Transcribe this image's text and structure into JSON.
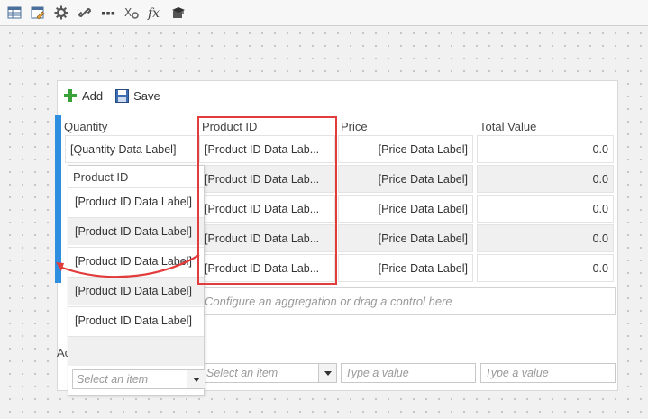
{
  "toolbar": {
    "icons": [
      "table-icon",
      "edit-form-icon",
      "gear-icon",
      "link-icon",
      "ellipsis-icon",
      "settings-code-icon",
      "function-icon",
      "graduation-cap-icon"
    ]
  },
  "commands": {
    "add_label": "Add",
    "save_label": "Save"
  },
  "columns": {
    "quantity": "Quantity",
    "product_id": "Product ID",
    "price": "Price",
    "total_value": "Total Value"
  },
  "rows": [
    {
      "quantity": "[Quantity Data Label]",
      "product_id": "[Product ID Data Lab...",
      "price": "[Price Data Label]",
      "total": "0.0"
    },
    {
      "quantity": "",
      "product_id": "[Product ID Data Lab...",
      "price": "[Price Data Label]",
      "total": "0.0"
    },
    {
      "quantity": "",
      "product_id": "[Product ID Data Lab...",
      "price": "[Price Data Label]",
      "total": "0.0"
    },
    {
      "quantity": "",
      "product_id": "[Product ID Data Lab...",
      "price": "[Price Data Label]",
      "total": "0.0"
    },
    {
      "quantity": "",
      "product_id": "[Product ID Data Lab...",
      "price": "[Price Data Label]",
      "total": "0.0"
    }
  ],
  "aggregation_placeholder": "Configure an aggregation or drag a control here",
  "aggregation_row": {
    "select_placeholder": "Select an item",
    "value_placeholder_1": "Type a value",
    "value_placeholder_2": "Type a value"
  },
  "drag_ghost": {
    "header": "Product ID",
    "cells": [
      "[Product ID Data Label]",
      "[Product ID Data Label]",
      "[Product ID Data Label]",
      "[Product ID Data Label]",
      "[Product ID Data Label]"
    ],
    "select_placeholder": "Select an item"
  },
  "partial_label": "Ac",
  "colors": {
    "accent_blue": "#2e8fe0",
    "highlight_red": "#e23b3b",
    "add_green": "#3aa13a"
  }
}
